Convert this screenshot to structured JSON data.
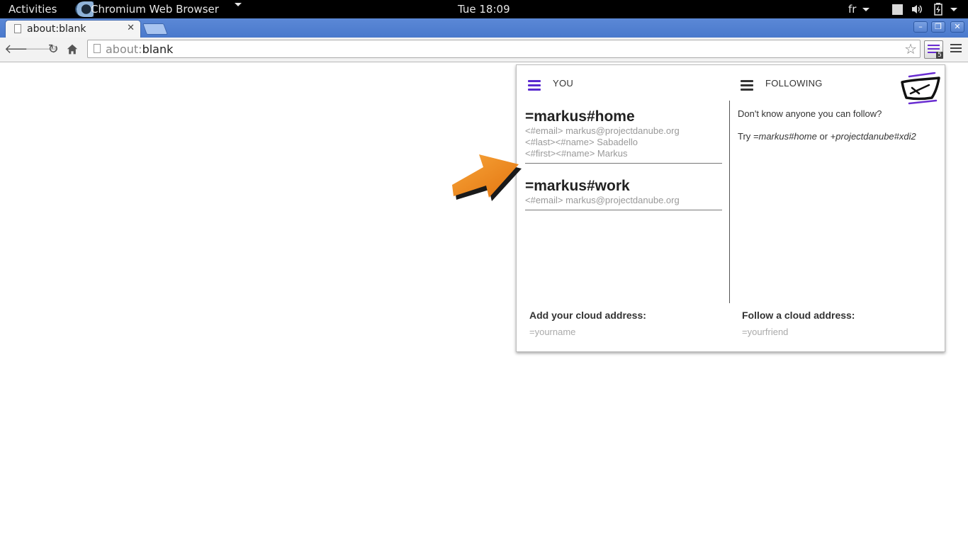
{
  "topbar": {
    "activities": "Activities",
    "app_name": "Chromium Web Browser",
    "clock": "Tue 18:09",
    "language": "fr"
  },
  "browser": {
    "tab_title": "about:blank",
    "url_scheme": "about:",
    "url_rest": "blank",
    "extension_badge": "5"
  },
  "popup": {
    "you_label": "YOU",
    "following_label": "FOLLOWING",
    "identities": [
      {
        "name": "=markus#home",
        "attributes": [
          "<#email> markus@projectdanube.org",
          "<#last><#name> Sabadello",
          "<#first><#name> Markus"
        ]
      },
      {
        "name": "=markus#work",
        "attributes": [
          "<#email> markus@projectdanube.org"
        ]
      }
    ],
    "following_empty_message": "Don't know anyone you can follow?",
    "following_try": {
      "prefix": "Try ",
      "example1": "=markus#home",
      "middle": " or ",
      "example2": "+projectdanube#xdi2"
    },
    "add_address_label": "Add your cloud address:",
    "add_address_placeholder": "=yourname",
    "follow_address_label": "Follow a cloud address:",
    "follow_address_placeholder": "=yourfriend"
  },
  "colors": {
    "accent_purple": "#5a2ad0",
    "arrow_orange": "#f08a1c",
    "tabstrip_blue": "#4a79cc"
  }
}
